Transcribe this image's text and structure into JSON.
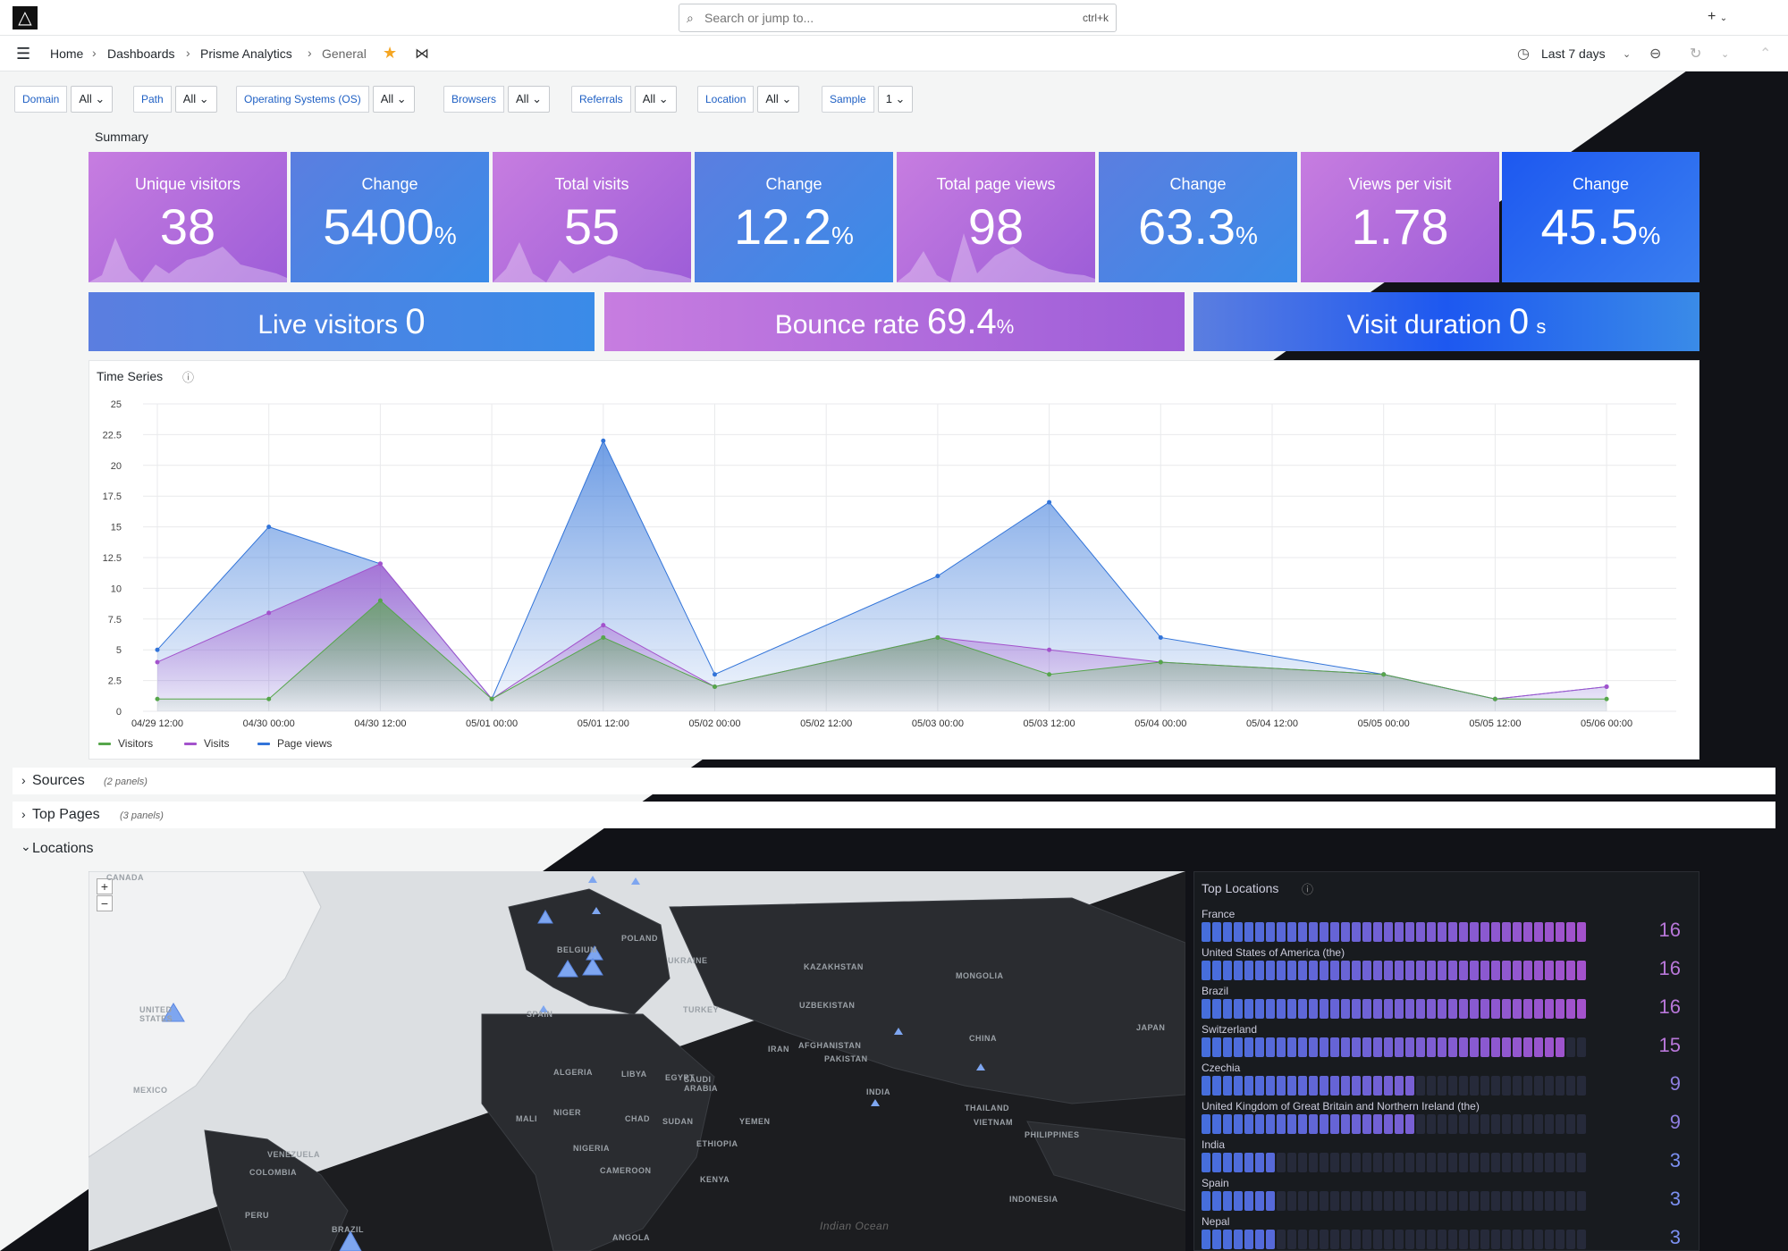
{
  "topbar": {
    "search_placeholder": "Search or jump to...",
    "shortcut": "ctrl+k",
    "add_label": "+"
  },
  "nav": {
    "breadcrumbs": [
      "Home",
      "Dashboards",
      "Prisme Analytics",
      "General"
    ],
    "time_range": "Last 7 days"
  },
  "variables": [
    {
      "label": "Domain",
      "value": "All"
    },
    {
      "label": "Path",
      "value": "All"
    },
    {
      "label": "Operating Systems (OS)",
      "value": "All"
    },
    {
      "label": "Browsers",
      "value": "All"
    },
    {
      "label": "Referrals",
      "value": "All"
    },
    {
      "label": "Location",
      "value": "All"
    },
    {
      "label": "Sample",
      "value": "1"
    }
  ],
  "summary": {
    "title": "Summary",
    "stats": [
      {
        "title": "Unique visitors",
        "value": "38",
        "unit": ""
      },
      {
        "title": "Change",
        "value": "5400",
        "unit": "%"
      },
      {
        "title": "Total visits",
        "value": "55",
        "unit": ""
      },
      {
        "title": "Change",
        "value": "12.2",
        "unit": "%"
      },
      {
        "title": "Total page views",
        "value": "98",
        "unit": ""
      },
      {
        "title": "Change",
        "value": "63.3",
        "unit": "%"
      },
      {
        "title": "Views per visit",
        "value": "1.78",
        "unit": ""
      },
      {
        "title": "Change",
        "value": "45.5",
        "unit": "%"
      }
    ],
    "wide": [
      {
        "title": "Live visitors",
        "value": "0",
        "unit": ""
      },
      {
        "title": "Bounce rate",
        "value": "69.4",
        "unit": "%"
      },
      {
        "title": "Visit duration",
        "value": "0",
        "unit": "s"
      }
    ]
  },
  "timeseries": {
    "title": "Time Series"
  },
  "chart_data": {
    "type": "area",
    "x": [
      "04/29 12:00",
      "04/30 00:00",
      "04/30 12:00",
      "05/01 00:00",
      "05/01 12:00",
      "05/02 00:00",
      "05/02 12:00",
      "05/03 00:00",
      "05/03 12:00",
      "05/04 00:00",
      "05/04 12:00",
      "05/05 00:00",
      "05/05 12:00",
      "05/06 00:00"
    ],
    "yticks": [
      "0",
      "2.5",
      "5",
      "7.5",
      "10",
      "12.5",
      "15",
      "17.5",
      "20",
      "22.5",
      "25"
    ],
    "ylim": [
      0,
      25
    ],
    "series": [
      {
        "name": "Visitors",
        "color": "#56a64b",
        "points": [
          [
            0,
            1
          ],
          [
            1,
            1
          ],
          [
            2,
            9
          ],
          [
            3,
            1
          ],
          [
            4,
            6
          ],
          [
            5,
            2
          ],
          [
            7,
            6
          ],
          [
            8,
            3
          ],
          [
            9,
            4
          ],
          [
            11,
            3
          ],
          [
            12,
            1
          ],
          [
            13,
            1
          ]
        ]
      },
      {
        "name": "Visits",
        "color": "#a352cc",
        "points": [
          [
            0,
            4
          ],
          [
            1,
            8
          ],
          [
            2,
            12
          ],
          [
            3,
            1
          ],
          [
            4,
            7
          ],
          [
            5,
            2
          ],
          [
            7,
            6
          ],
          [
            8,
            5
          ],
          [
            9,
            4
          ],
          [
            11,
            3
          ],
          [
            12,
            1
          ],
          [
            13,
            2
          ]
        ]
      },
      {
        "name": "Page views",
        "color": "#3274d9",
        "points": [
          [
            0,
            5
          ],
          [
            1,
            15
          ],
          [
            2,
            12
          ],
          [
            3,
            1
          ],
          [
            4,
            22
          ],
          [
            5,
            3
          ],
          [
            7,
            11
          ],
          [
            8,
            17
          ],
          [
            9,
            6
          ],
          [
            11,
            3
          ],
          [
            12,
            1
          ],
          [
            13,
            2
          ]
        ]
      }
    ],
    "legend": "bottom-left"
  },
  "rows": [
    {
      "title": "Sources",
      "count": "(2 panels)",
      "collapsed": true
    },
    {
      "title": "Top Pages",
      "count": "(3 panels)",
      "collapsed": true
    },
    {
      "title": "Locations",
      "count": "",
      "collapsed": false
    }
  ],
  "map": {
    "labels": [
      {
        "text": "CANADA"
      },
      {
        "text": "UNITED STATES"
      },
      {
        "text": "MEXICO"
      },
      {
        "text": "VENEZUELA"
      },
      {
        "text": "COLOMBIA"
      },
      {
        "text": "PERU"
      },
      {
        "text": "BRAZIL"
      },
      {
        "text": "KAZAKHSTAN"
      },
      {
        "text": "MONGOLIA"
      },
      {
        "text": "CHINA"
      },
      {
        "text": "INDIA"
      },
      {
        "text": "PAKISTAN"
      },
      {
        "text": "AFGHANISTAN"
      },
      {
        "text": "IRAN"
      },
      {
        "text": "TURKEY"
      },
      {
        "text": "UKRAINE"
      },
      {
        "text": "POLAND"
      },
      {
        "text": "BELGIUM"
      },
      {
        "text": "SPAIN"
      },
      {
        "text": "ALGERIA"
      },
      {
        "text": "LIBYA"
      },
      {
        "text": "EGYPT"
      },
      {
        "text": "MALI"
      },
      {
        "text": "NIGER"
      },
      {
        "text": "CHAD"
      },
      {
        "text": "SUDAN"
      },
      {
        "text": "ETHIOPIA"
      },
      {
        "text": "NIGERIA"
      },
      {
        "text": "KENYA"
      },
      {
        "text": "ANGOLA"
      },
      {
        "text": "SAUDI ARABIA"
      },
      {
        "text": "YEMEN"
      },
      {
        "text": "JAPAN"
      },
      {
        "text": "PHILIPPINES"
      },
      {
        "text": "INDONESIA"
      },
      {
        "text": "THAILAND"
      },
      {
        "text": "VIETNAM"
      },
      {
        "text": "CAMEROON"
      },
      {
        "text": "UZBEKISTAN"
      },
      {
        "text": "Indian Ocean"
      }
    ]
  },
  "top_locations": {
    "title": "Top Locations",
    "max": 16,
    "items": [
      {
        "name": "France",
        "value": 16
      },
      {
        "name": "United States of America (the)",
        "value": 16
      },
      {
        "name": "Brazil",
        "value": 16
      },
      {
        "name": "Switzerland",
        "value": 15
      },
      {
        "name": "Czechia",
        "value": 9
      },
      {
        "name": "United Kingdom of Great Britain and Northern Ireland (the)",
        "value": 9
      },
      {
        "name": "India",
        "value": 3
      },
      {
        "name": "Spain",
        "value": 3
      },
      {
        "name": "Nepal",
        "value": 3
      }
    ]
  },
  "colors": {
    "purple": "#a352cc",
    "blue": "#3274d9",
    "green": "#56a64b",
    "accent": "#1f60c4",
    "star": "#f5a623"
  }
}
